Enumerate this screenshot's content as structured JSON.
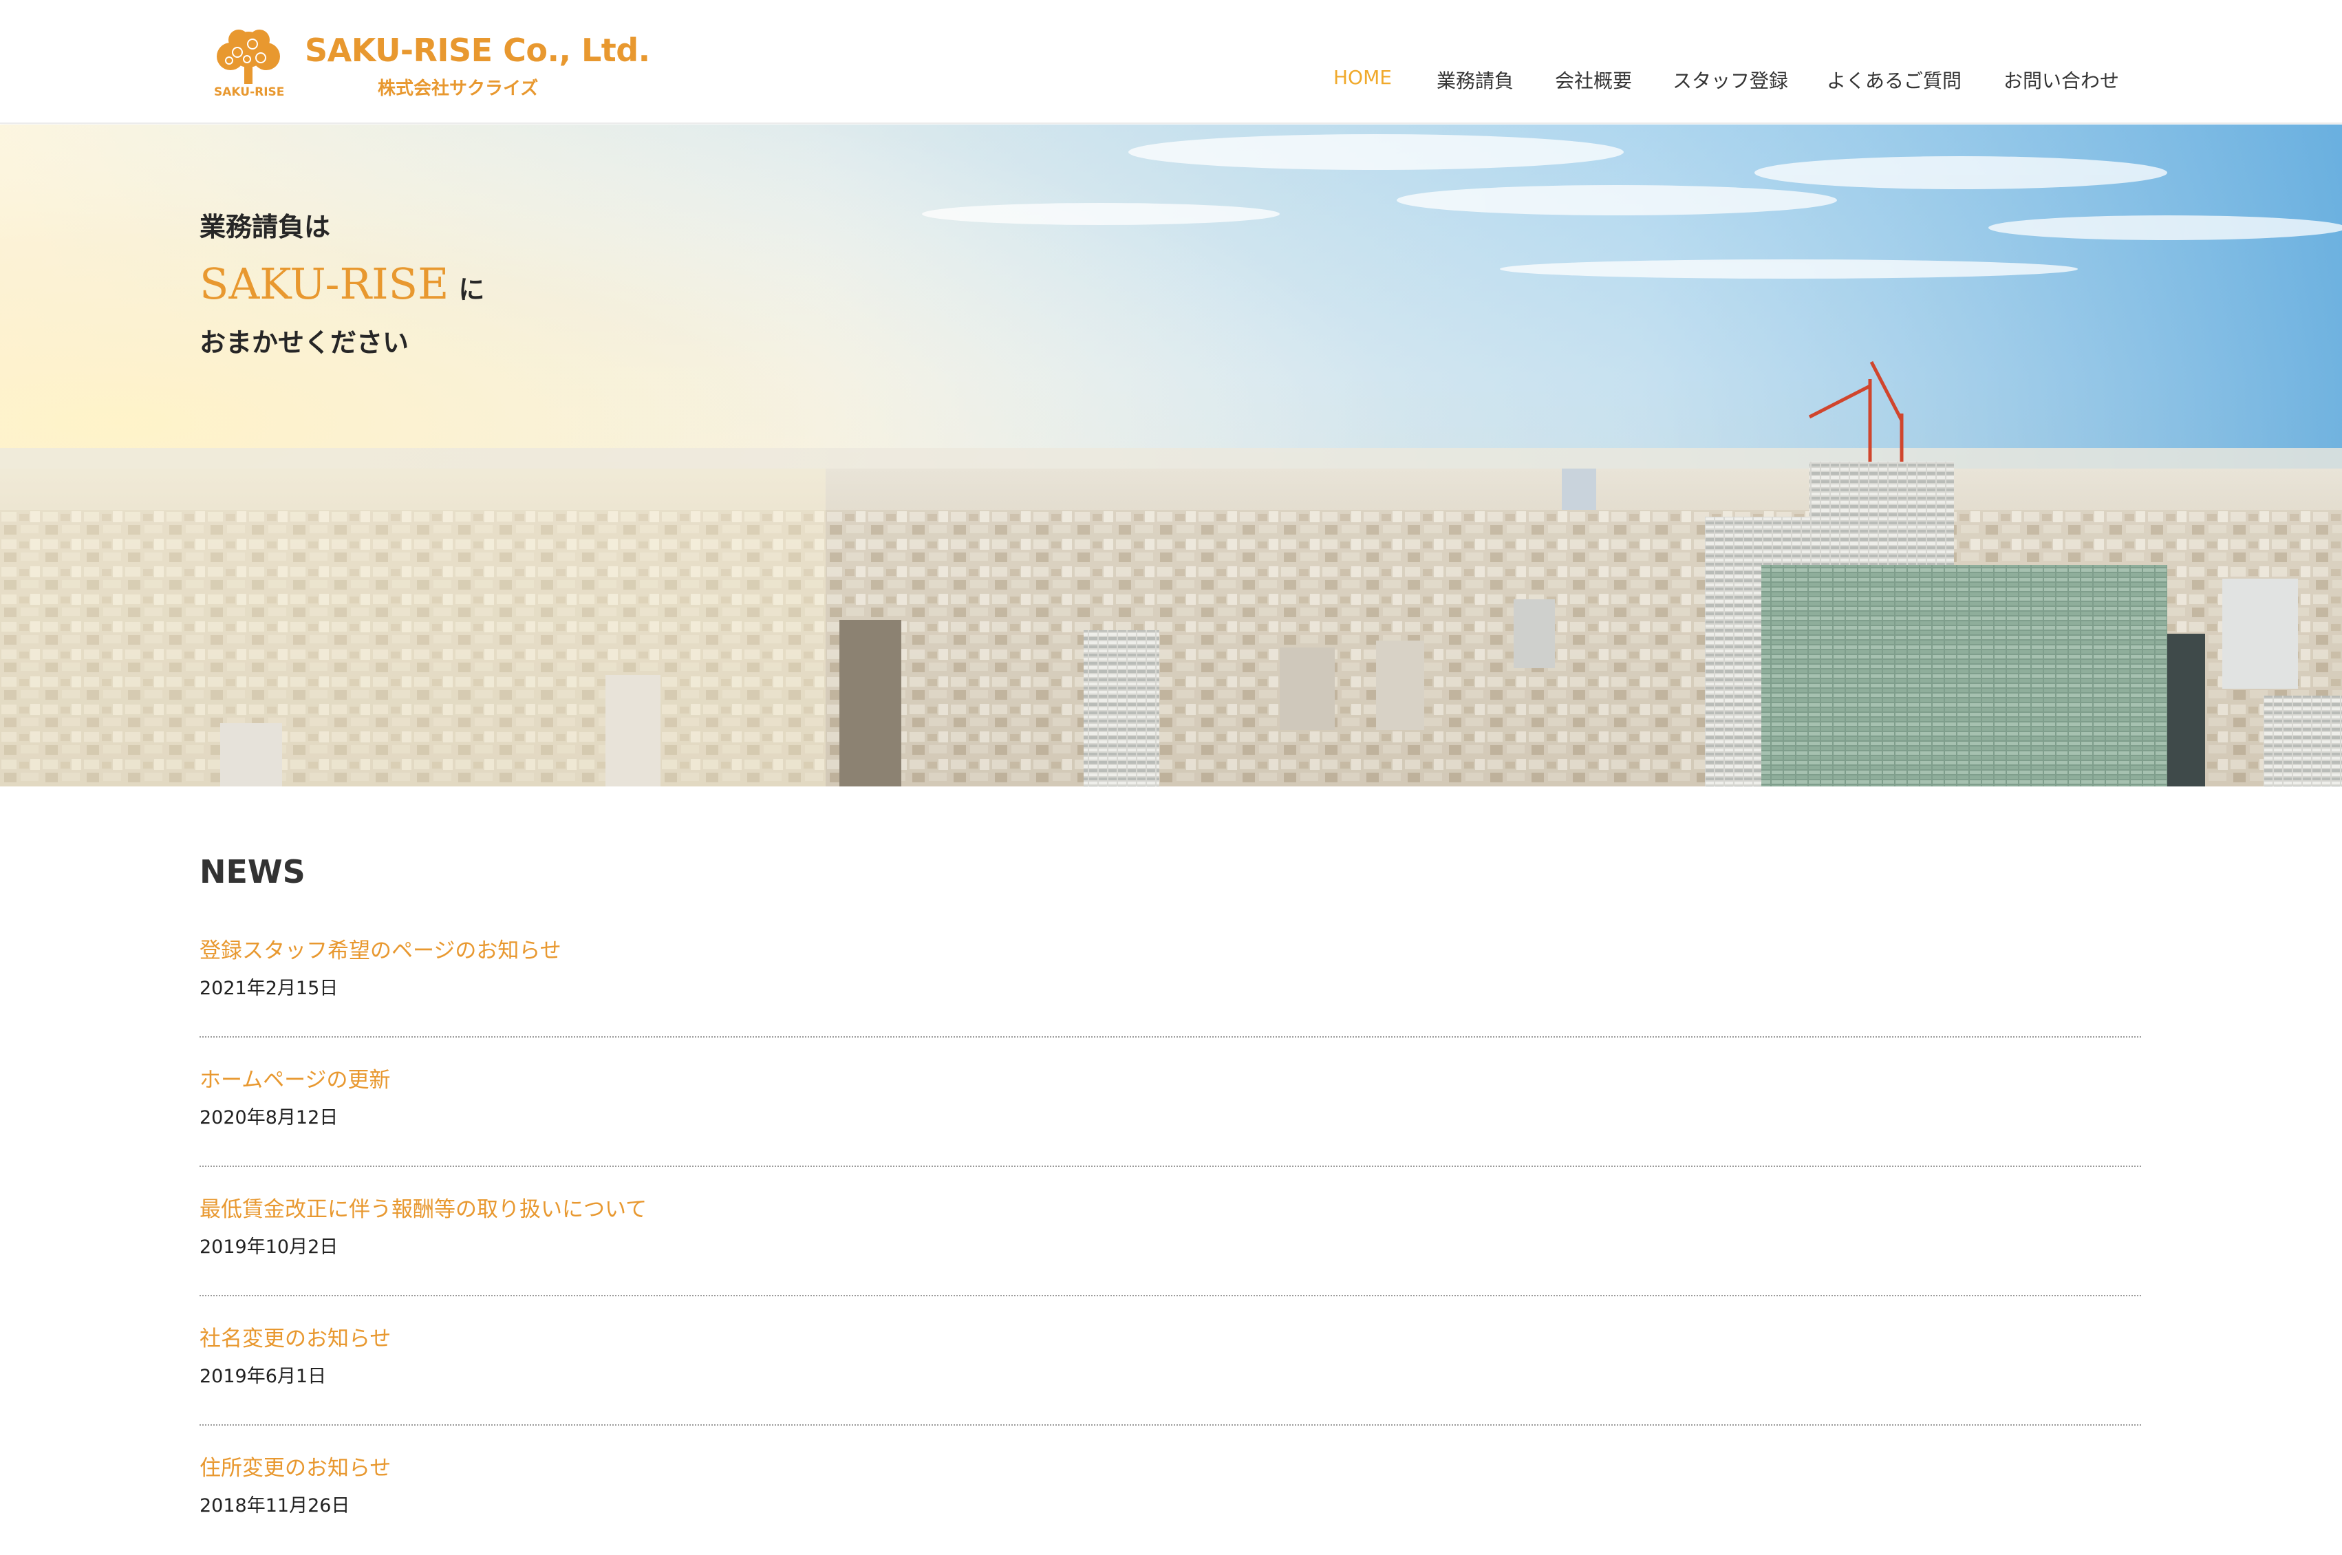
{
  "site": {
    "logo_mark_text": "SAKU-RISE",
    "company_name": "SAKU-RISE Co., Ltd.",
    "company_name_ja": "株式会社サクライズ",
    "brand_color": "#e8982f"
  },
  "nav": {
    "items": [
      {
        "label": "HOME",
        "active": true
      },
      {
        "label": "業務請負",
        "active": false
      },
      {
        "label": "会社概要",
        "active": false
      },
      {
        "label": "スタッフ登録",
        "active": false
      },
      {
        "label": "よくあるご質問",
        "active": false
      },
      {
        "label": "お問い合わせ",
        "active": false
      }
    ],
    "active_color": "#f0a92b"
  },
  "hero": {
    "line1": "業務請負は",
    "brand": "SAKU-RISE",
    "particle": "に",
    "line3": "おまかせください"
  },
  "news": {
    "title": "NEWS",
    "items": [
      {
        "title": "登録スタッフ希望のページのお知らせ",
        "date": "2021年2月15日"
      },
      {
        "title": "ホームページの更新",
        "date": "2020年8月12日"
      },
      {
        "title": "最低賃金改正に伴う報酬等の取り扱いについて",
        "date": "2019年10月2日"
      },
      {
        "title": "社名変更のお知らせ",
        "date": "2019年6月1日"
      },
      {
        "title": "住所変更のお知らせ",
        "date": "2018年11月26日"
      }
    ]
  }
}
